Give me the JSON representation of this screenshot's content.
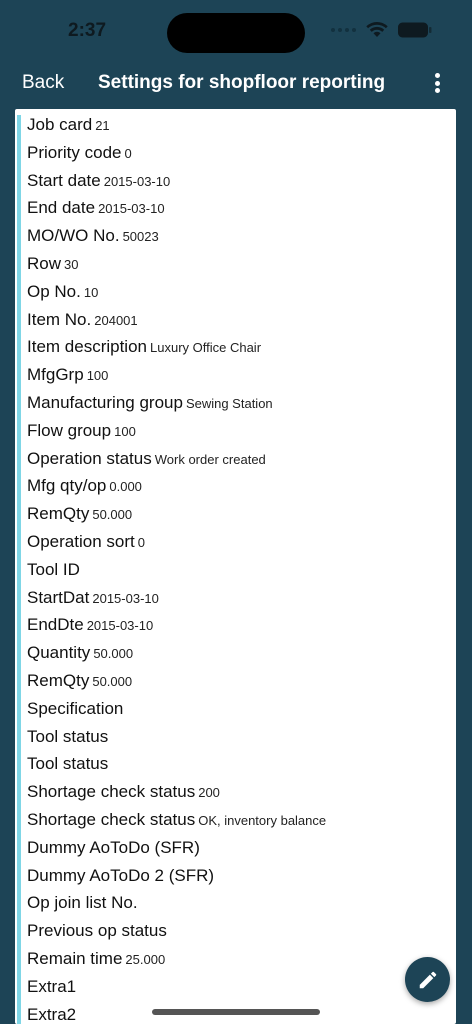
{
  "status_bar": {
    "time": "2:37",
    "icons": [
      "cellular-signal-icon",
      "wifi-icon",
      "battery-icon"
    ]
  },
  "nav": {
    "back_label": "Back",
    "title": "Settings for shopfloor reporting",
    "more_icon": "more-vertical-icon"
  },
  "colors": {
    "header_bg": "#1d4456",
    "accent": "#7fd6e6",
    "card_bg": "#ffffff",
    "fab_bg": "#1d4456"
  },
  "fields": [
    {
      "label": "Job card",
      "value": "21"
    },
    {
      "label": "Priority code",
      "value": "0"
    },
    {
      "label": "Start date",
      "value": "2015-03-10"
    },
    {
      "label": "End date",
      "value": "2015-03-10"
    },
    {
      "label": "MO/WO No.",
      "value": "50023"
    },
    {
      "label": "Row",
      "value": "30"
    },
    {
      "label": "Op No.",
      "value": "10"
    },
    {
      "label": "Item No.",
      "value": "204001"
    },
    {
      "label": "Item description",
      "value": "Luxury Office Chair"
    },
    {
      "label": "MfgGrp",
      "value": "100"
    },
    {
      "label": "Manufacturing group",
      "value": "Sewing Station"
    },
    {
      "label": "Flow group",
      "value": "100"
    },
    {
      "label": "Operation status",
      "value": "Work order created"
    },
    {
      "label": "Mfg qty/op",
      "value": "0.000"
    },
    {
      "label": "RemQty",
      "value": "50.000"
    },
    {
      "label": "Operation sort",
      "value": "0"
    },
    {
      "label": "Tool ID",
      "value": ""
    },
    {
      "label": "StartDat",
      "value": "2015-03-10"
    },
    {
      "label": "EndDte",
      "value": "2015-03-10"
    },
    {
      "label": "Quantity",
      "value": "50.000"
    },
    {
      "label": "RemQty",
      "value": "50.000"
    },
    {
      "label": "Specification",
      "value": ""
    },
    {
      "label": "Tool status",
      "value": ""
    },
    {
      "label": "Tool status",
      "value": ""
    },
    {
      "label": "Shortage check status",
      "value": "200"
    },
    {
      "label": "Shortage check status",
      "value": "OK, inventory balance"
    },
    {
      "label": "Dummy AoToDo (SFR)",
      "value": ""
    },
    {
      "label": "Dummy AoToDo 2 (SFR)",
      "value": ""
    },
    {
      "label": "Op join list No.",
      "value": ""
    },
    {
      "label": "Previous op status",
      "value": ""
    },
    {
      "label": "Remain time",
      "value": "25.000"
    },
    {
      "label": "Extra1",
      "value": ""
    },
    {
      "label": "Extra2",
      "value": ""
    }
  ],
  "fab": {
    "icon": "edit-pencil-icon"
  }
}
